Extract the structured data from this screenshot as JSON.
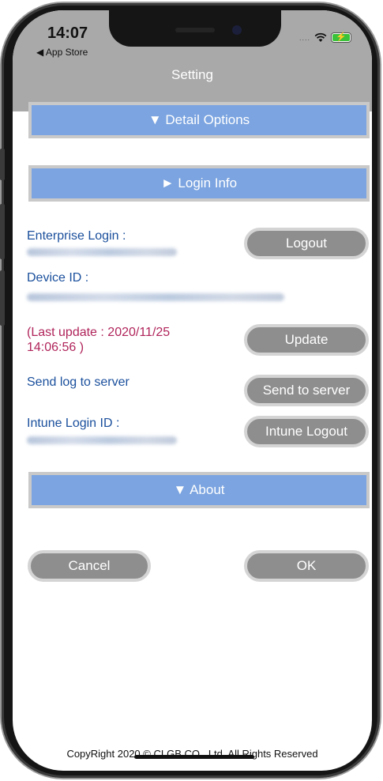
{
  "status": {
    "time": "14:07",
    "back_app": "◀ App Store",
    "signal": "....",
    "battery_bolt": "⚡"
  },
  "nav": {
    "title": "Setting"
  },
  "sections": {
    "detail_options": "▼ Detail Options",
    "login_info": "► Login Info",
    "about": "▼ About"
  },
  "login": {
    "enterprise_label": "Enterprise Login :",
    "logout_button": "Logout",
    "device_id_label": "Device ID :",
    "last_update": "(Last update : 2020/11/25 14:06:56 )",
    "update_button": "Update",
    "send_log_label": "Send log to server",
    "send_button": "Send to server",
    "intune_label": "Intune Login ID :",
    "intune_logout_button": "Intune Logout"
  },
  "actions": {
    "cancel": "Cancel",
    "ok": "OK"
  },
  "footer": {
    "copyright": "CopyRight 2020 © CLGB CO., Ltd. All Rights Reserved"
  },
  "colors": {
    "section_bar": "#7ba4e0",
    "button": "#8e8e8e",
    "label_blue": "#1a4f9c",
    "warning_magenta": "#b0245a",
    "nav_gray": "#a9a9a9"
  }
}
